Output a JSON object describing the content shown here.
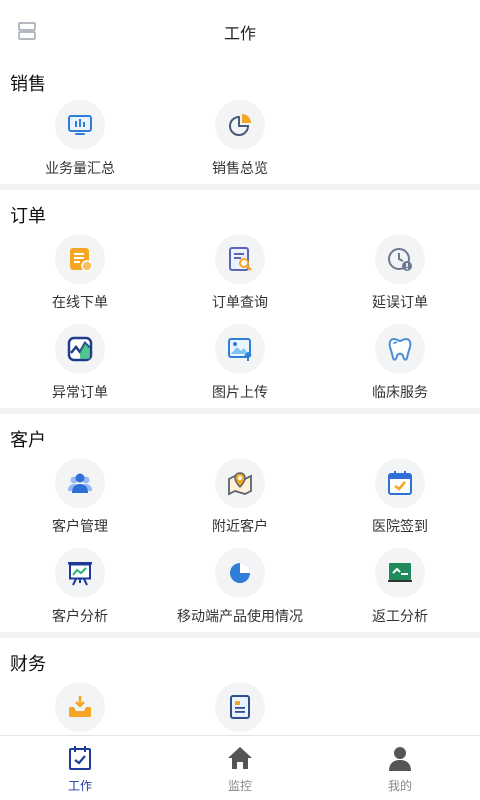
{
  "header": {
    "title": "工作",
    "menu_icon": "menu-icon"
  },
  "colors": {
    "accent": "#1d3b99",
    "icon_bg": "#f3f4f6",
    "divider": "#f2f2f2"
  },
  "sections": [
    {
      "title": "销售",
      "items": [
        {
          "label": "业务量汇总",
          "icon": "monitor-chart-icon"
        },
        {
          "label": "销售总览",
          "icon": "pie-chart-icon"
        }
      ]
    },
    {
      "title": "订单",
      "items": [
        {
          "label": "在线下单",
          "icon": "order-form-icon"
        },
        {
          "label": "订单查询",
          "icon": "order-search-icon"
        },
        {
          "label": "延误订单",
          "icon": "clock-alert-icon"
        },
        {
          "label": "异常订单",
          "icon": "anomaly-chart-icon"
        },
        {
          "label": "图片上传",
          "icon": "image-upload-icon"
        },
        {
          "label": "临床服务",
          "icon": "tooth-icon"
        }
      ]
    },
    {
      "title": "客户",
      "items": [
        {
          "label": "客户管理",
          "icon": "users-icon"
        },
        {
          "label": "附近客户",
          "icon": "map-pin-icon"
        },
        {
          "label": "医院签到",
          "icon": "calendar-check-icon"
        },
        {
          "label": "客户分析",
          "icon": "presentation-icon"
        },
        {
          "label": "移动端产品使用情况",
          "icon": "pie-stat-icon"
        },
        {
          "label": "返工分析",
          "icon": "board-chart-icon"
        }
      ]
    },
    {
      "title": "财务",
      "items": [
        {
          "label": "",
          "icon": "inbox-download-icon"
        },
        {
          "label": "",
          "icon": "invoice-icon"
        }
      ]
    }
  ],
  "tabbar": [
    {
      "label": "工作",
      "icon": "calendar-check-icon",
      "active": true
    },
    {
      "label": "监控",
      "icon": "home-icon",
      "active": false
    },
    {
      "label": "我的",
      "icon": "person-icon",
      "active": false
    }
  ]
}
